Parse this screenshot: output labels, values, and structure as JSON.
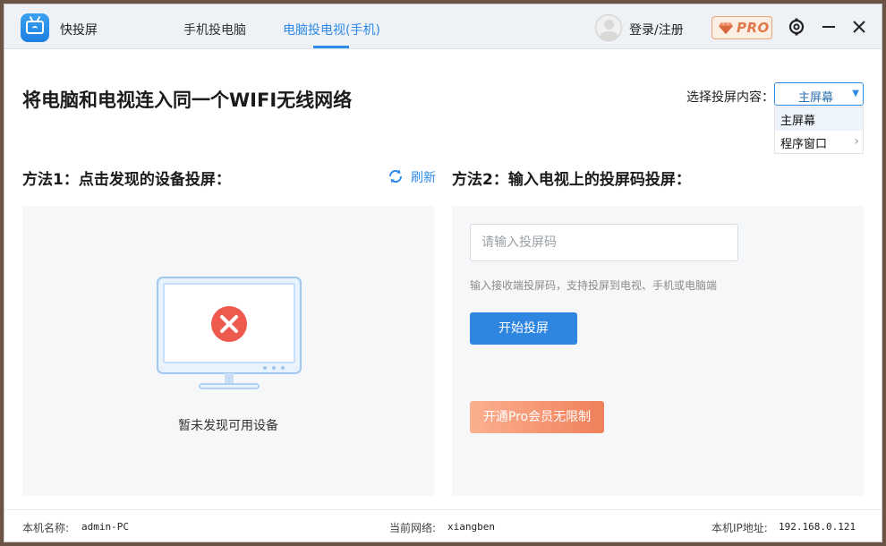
{
  "app": {
    "name": "快投屏",
    "tabs": [
      {
        "label": "手机投电脑",
        "active": false
      },
      {
        "label": "电脑投电视(手机)",
        "active": true
      }
    ],
    "login_label": "登录/注册",
    "pro_badge": "PRO"
  },
  "main": {
    "headline": "将电脑和电视连入同一个WIFI无线网络",
    "select_label": "选择投屏内容：",
    "select_value": "主屏幕",
    "select_options": [
      "主屏幕",
      "程序窗口"
    ]
  },
  "method1": {
    "title": "方法1：点击发现的设备投屏：",
    "refresh_label": "刷新",
    "empty_text": "暂未发现可用设备"
  },
  "method2": {
    "title": "方法2：输入电视上的投屏码投屏：",
    "input_placeholder": "请输入投屏码",
    "input_value": "",
    "hint": "输入接收端投屏码，支持投屏到电视、手机或电脑端",
    "start_button": "开始投屏",
    "pro_button": "开通Pro会员无限制"
  },
  "status": {
    "machine_label": "本机名称:",
    "machine_value": "admin-PC",
    "network_label": "当前网络:",
    "network_value": "xiangben",
    "ip_label": "本机IP地址:",
    "ip_value": "192.168.0.121"
  },
  "colors": {
    "accent": "#2e8ae6",
    "pro": "#f0805a",
    "error": "#ef5a4f"
  },
  "icons": {
    "settings": "gear-icon",
    "minimize": "minimize-icon",
    "close": "close-icon",
    "refresh": "refresh-icon"
  }
}
